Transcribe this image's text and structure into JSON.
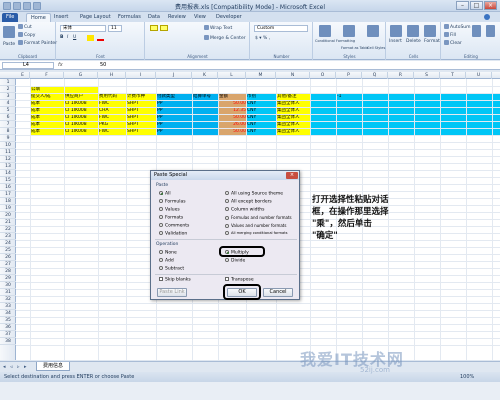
{
  "app": {
    "title": "费用报表.xls [Compatibility Mode] - Microsoft Excel"
  },
  "ribbon": {
    "tabs": [
      "File",
      "Home",
      "Insert",
      "Page Layout",
      "Formulas",
      "Data",
      "Review",
      "View",
      "Developer"
    ],
    "clipboard": {
      "paste": "Paste",
      "cut": "Cut",
      "copy": "Copy",
      "format_painter": "Format Painter",
      "label": "Clipboard"
    },
    "font": {
      "name": "宋体",
      "size": "11",
      "label": "Font"
    },
    "alignment": {
      "wrap": "Wrap Text",
      "merge": "Merge & Center",
      "label": "Alignment"
    },
    "number": {
      "format": "Custom",
      "label": "Number"
    },
    "styles": {
      "conditional": "Conditional Formatting",
      "table": "Format as Table",
      "cell": "Cell Styles",
      "label": "Styles"
    },
    "cells": {
      "insert": "Insert",
      "delete": "Delete",
      "format": "Format",
      "label": "Cells"
    },
    "editing": {
      "autosum": "AutoSum",
      "fill": "Fill",
      "clear": "Clear",
      "sort": "Sort & Filter",
      "find": "Find & Select",
      "label": "Editing"
    }
  },
  "formula_bar": {
    "name_box": "L4",
    "fx": "fx",
    "value": "50"
  },
  "columns": [
    "E",
    "F",
    "G",
    "H",
    "I",
    "J",
    "K",
    "L",
    "M",
    "N",
    "O",
    "P",
    "Q",
    "R",
    "S",
    "T",
    "U",
    "V"
  ],
  "rows": [
    "1",
    "2",
    "3",
    "4",
    "5",
    "6",
    "7",
    "8",
    "9",
    "10",
    "11",
    "12",
    "13",
    "14",
    "15",
    "16",
    "17",
    "18",
    "19",
    "20",
    "21",
    "22",
    "23",
    "24",
    "25",
    "26",
    "27",
    "28",
    "29",
    "30",
    "31",
    "32",
    "33",
    "34",
    "35",
    "36",
    "37",
    "38"
  ],
  "sheet": {
    "title_cell": "公填",
    "headers": [
      "提交人/成",
      "供应商户",
      "费用代码",
      "计费币种",
      "付款类型",
      "结算单号",
      "金额",
      "币别",
      "其他/备注"
    ],
    "rows": [
      [
        "成本",
        "CI 1IK008",
        "FWC",
        "SHPT",
        "PP",
        "",
        "50.00",
        "CNY",
        "集团全体人"
      ],
      [
        "成本",
        "CI 1IK008",
        "CHA",
        "SHPT",
        "PP",
        "",
        "12.35",
        "CNY",
        "集团全体人"
      ],
      [
        "成本",
        "CI 1IK008",
        "FWC",
        "SHPT",
        "PP",
        "",
        "50.00",
        "CNY",
        "集团全体人"
      ],
      [
        "成本",
        "CI 1IK008",
        "PKG",
        "SHPT",
        "PP",
        "",
        "26.00",
        "CNY",
        "集团全体人"
      ],
      [
        "成本",
        "CI 1IK008",
        "FWC",
        "SHPT",
        "PP",
        "",
        "50.00",
        "CNY",
        "集团全体人"
      ]
    ],
    "side_value": "-1"
  },
  "dialog": {
    "title": "Paste Special",
    "paste_label": "Paste",
    "paste_left": [
      "All",
      "Formulas",
      "Values",
      "Formats",
      "Comments",
      "Validation"
    ],
    "paste_right": [
      "All using Source theme",
      "All except borders",
      "Column widths",
      "Formulas and number formats",
      "Values and number formats",
      "All merging conditional formats"
    ],
    "operation_label": "Operation",
    "operation_left": [
      "None",
      "Add",
      "Subtract"
    ],
    "operation_right": [
      "Multiply",
      "Divide"
    ],
    "skip_blanks": "Skip blanks",
    "transpose": "Transpose",
    "paste_link": "Paste Link",
    "ok": "OK",
    "cancel": "Cancel",
    "selected_paste": "All",
    "selected_operation": "Multiply"
  },
  "annotation": {
    "line1": "打开选择性粘贴对话",
    "line2": "框，在操作那里选择",
    "line3": "\"乘\"，然后单击",
    "line4": "\"确定\""
  },
  "sheet_tabs": [
    "费用信息"
  ],
  "status": {
    "message": "Select destination and press ENTER or choose Paste",
    "zoom": "100%"
  },
  "watermark": {
    "main": "我爱IT技术网",
    "sub": "52ij.com"
  }
}
